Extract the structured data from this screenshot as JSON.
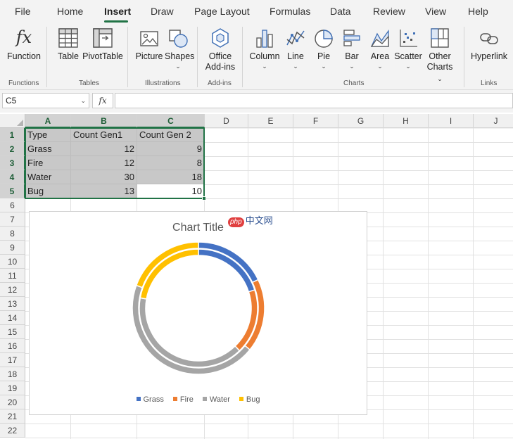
{
  "tabs": [
    "File",
    "Home",
    "Insert",
    "Draw",
    "Page Layout",
    "Formulas",
    "Data",
    "Review",
    "View",
    "Help"
  ],
  "active_tab": "Insert",
  "ribbon": {
    "function_label": "Function",
    "table_label": "Table",
    "pivottable_label": "PivotTable",
    "picture_label": "Picture",
    "shapes_label": "Shapes",
    "office_addins_label": [
      "Office",
      "Add-ins"
    ],
    "column_label": "Column",
    "line_label": "Line",
    "pie_label": "Pie",
    "bar_label": "Bar",
    "area_label": "Area",
    "scatter_label": "Scatter",
    "other_charts_label": [
      "Other",
      "Charts"
    ],
    "hyperlink_label": "Hyperlink",
    "groups": [
      "Functions",
      "Tables",
      "Illustrations",
      "Add-ins",
      "Charts",
      "Links"
    ]
  },
  "formula_bar": {
    "name_box": "C5",
    "fx_label": "fx",
    "formula": ""
  },
  "sheet": {
    "columns": [
      "A",
      "B",
      "C",
      "D",
      "E",
      "F",
      "G",
      "H",
      "I",
      "J"
    ],
    "rows": [
      "1",
      "2",
      "3",
      "4",
      "5",
      "6",
      "7",
      "8",
      "9",
      "10",
      "11",
      "12",
      "13",
      "14",
      "15",
      "16",
      "17",
      "18",
      "19",
      "20",
      "21",
      "22"
    ],
    "cells": [
      [
        "Type",
        "Count Gen1",
        "Count Gen 2"
      ],
      [
        "Grass",
        "12",
        "9"
      ],
      [
        "Fire",
        "12",
        "8"
      ],
      [
        "Water",
        "30",
        "18"
      ],
      [
        "Bug",
        "13",
        "10"
      ]
    ]
  },
  "chart_data": {
    "type": "pie",
    "subtype": "doughnut",
    "title": "Chart Title",
    "categories": [
      "Grass",
      "Fire",
      "Water",
      "Bug"
    ],
    "series": [
      {
        "name": "Count Gen1",
        "values": [
          12,
          12,
          30,
          13
        ]
      },
      {
        "name": "Count Gen 2",
        "values": [
          9,
          8,
          18,
          10
        ]
      }
    ],
    "colors": [
      "#4472c4",
      "#ed7d31",
      "#a5a5a5",
      "#ffc000"
    ],
    "legend_position": "bottom"
  },
  "watermark": {
    "badge": "php",
    "text": "中文网"
  },
  "colors": {
    "accent": "#217346",
    "selection_fill": "#c8c8c8"
  }
}
